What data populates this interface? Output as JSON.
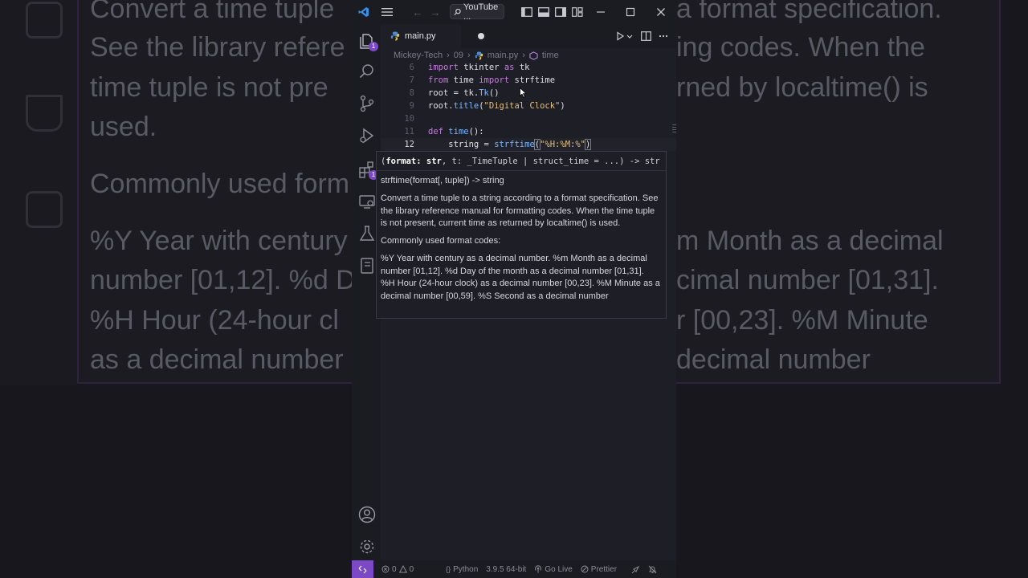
{
  "background": {
    "lines": [
      "Convert a time tuple",
      "See the library refere",
      "time tuple is not pre",
      "used.",
      "Commonly used form",
      "%Y Year with century",
      "number [01,12]. %d D",
      "%H Hour (24-hour cl",
      "as a decimal number"
    ],
    "right_lines": [
      "a format specification.",
      "ing codes. When the",
      "rned by localtime() is",
      "m Month as a decimal",
      "cimal number [01,31].",
      "r [00,23]. %M Minute",
      "decimal number"
    ]
  },
  "titlebar": {
    "search_label": "YouTube ..."
  },
  "activity": {
    "explorer_badge": "1",
    "extensions_badge": "1"
  },
  "tab": {
    "filename": "main.py"
  },
  "breadcrumb": {
    "root": "Mickey-Tech",
    "folder": "09",
    "file": "main.py",
    "symbol": "time"
  },
  "code": {
    "line_numbers": [
      "6",
      "7",
      "8",
      "9",
      "10",
      "11",
      "12"
    ],
    "l6": {
      "a": "import",
      "b": " tkinter ",
      "c": "as",
      "d": " tk"
    },
    "l7": {
      "a": "from",
      "b": " time ",
      "c": "import",
      "d": " strftime"
    },
    "l8": {
      "a": "root = tk.",
      "b": "Tk",
      "c": "()"
    },
    "l9": {
      "a": "root.",
      "b": "title",
      "c": "(",
      "d": "\"Digital Clock\"",
      "e": ")"
    },
    "l11": {
      "a": "def",
      "b": " ",
      "c": "time",
      "d": "():"
    },
    "l12": {
      "a": "    string = ",
      "b": "strftime",
      "c": "(",
      "d": "\"%H:%M:%\"",
      "e": ")"
    }
  },
  "hover": {
    "sig_open": "(",
    "sig_param": "format: str",
    "sig_rest": ", t: _TimeTuple | struct_time = ...) -> str",
    "p1": "strftime(format[, tuple]) -> string",
    "p2": "Convert a time tuple to a string according to a format specification. See the library reference manual for formatting codes. When the time tuple is not present, current time as returned by localtime() is used.",
    "p3": "Commonly used format codes:",
    "p4": "%Y Year with century as a decimal number. %m Month as a decimal number [01,12]. %d Day of the month as a decimal number [01,31]. %H Hour (24-hour clock) as a decimal number [00,23]. %M Minute as a decimal number [00,59]. %S Second as a decimal number"
  },
  "statusbar": {
    "errors": "0",
    "warnings": "0",
    "language": "Python",
    "interpreter": "3.9.5 64-bit",
    "live": "Go Live",
    "prettier": "Prettier"
  },
  "colors": {
    "accent": "#7b49c6",
    "keyword": "#c77de0",
    "function": "#79b8ff",
    "string": "#e6c07b"
  }
}
